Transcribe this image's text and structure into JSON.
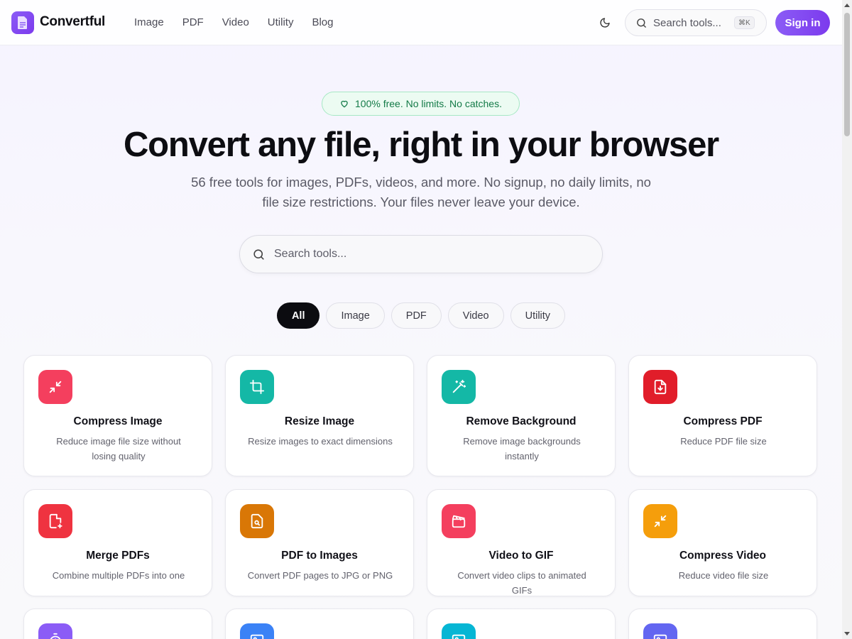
{
  "header": {
    "brand": "Convertful",
    "nav": [
      "Image",
      "PDF",
      "Video",
      "Utility",
      "Blog"
    ],
    "search_placeholder": "Search tools...",
    "search_shortcut": "⌘K",
    "signin_label": "Sign in"
  },
  "hero": {
    "badge": "100% free. No limits. No catches.",
    "title": "Convert any file, right in your browser",
    "subtitle_line1": "56 free tools for images, PDFs, videos, and more. No signup, no daily limits, no",
    "subtitle_line2": "file size restrictions. Your files never leave your device.",
    "search_placeholder": "Search tools..."
  },
  "filters": {
    "active": "All",
    "items": [
      "All",
      "Image",
      "PDF",
      "Video",
      "Utility"
    ]
  },
  "tools": [
    {
      "title": "Compress Image",
      "desc": "Reduce image file size without losing quality",
      "icon": "compress-arrows-icon",
      "color": "#f43f5e"
    },
    {
      "title": "Resize Image",
      "desc": "Resize images to exact dimensions",
      "icon": "crop-icon",
      "color": "#14b8a6"
    },
    {
      "title": "Remove Background",
      "desc": "Remove image backgrounds instantly",
      "icon": "magic-wand-icon",
      "color": "#14b8a6"
    },
    {
      "title": "Compress PDF",
      "desc": "Reduce PDF file size",
      "icon": "file-download-icon",
      "color": "#e11d2a"
    },
    {
      "title": "Merge PDFs",
      "desc": "Combine multiple PDFs into one",
      "icon": "file-plus-icon",
      "color": "#ef3340"
    },
    {
      "title": "PDF to Images",
      "desc": "Convert PDF pages to JPG or PNG",
      "icon": "file-search-icon",
      "color": "#d97706"
    },
    {
      "title": "Video to GIF",
      "desc": "Convert video clips to animated GIFs",
      "icon": "clapperboard-icon",
      "color": "#f43f5e"
    },
    {
      "title": "Compress Video",
      "desc": "Reduce video file size",
      "icon": "compress-arrows-icon",
      "color": "#f59e0b"
    },
    {
      "title": "",
      "desc": "",
      "icon": "timer-icon",
      "color": "#8b5cf6"
    },
    {
      "title": "",
      "desc": "",
      "icon": "image-icon",
      "color": "#3b82f6"
    },
    {
      "title": "",
      "desc": "",
      "icon": "image-icon",
      "color": "#06b6d4"
    },
    {
      "title": "",
      "desc": "",
      "icon": "image-icon",
      "color": "#6366f1"
    }
  ]
}
